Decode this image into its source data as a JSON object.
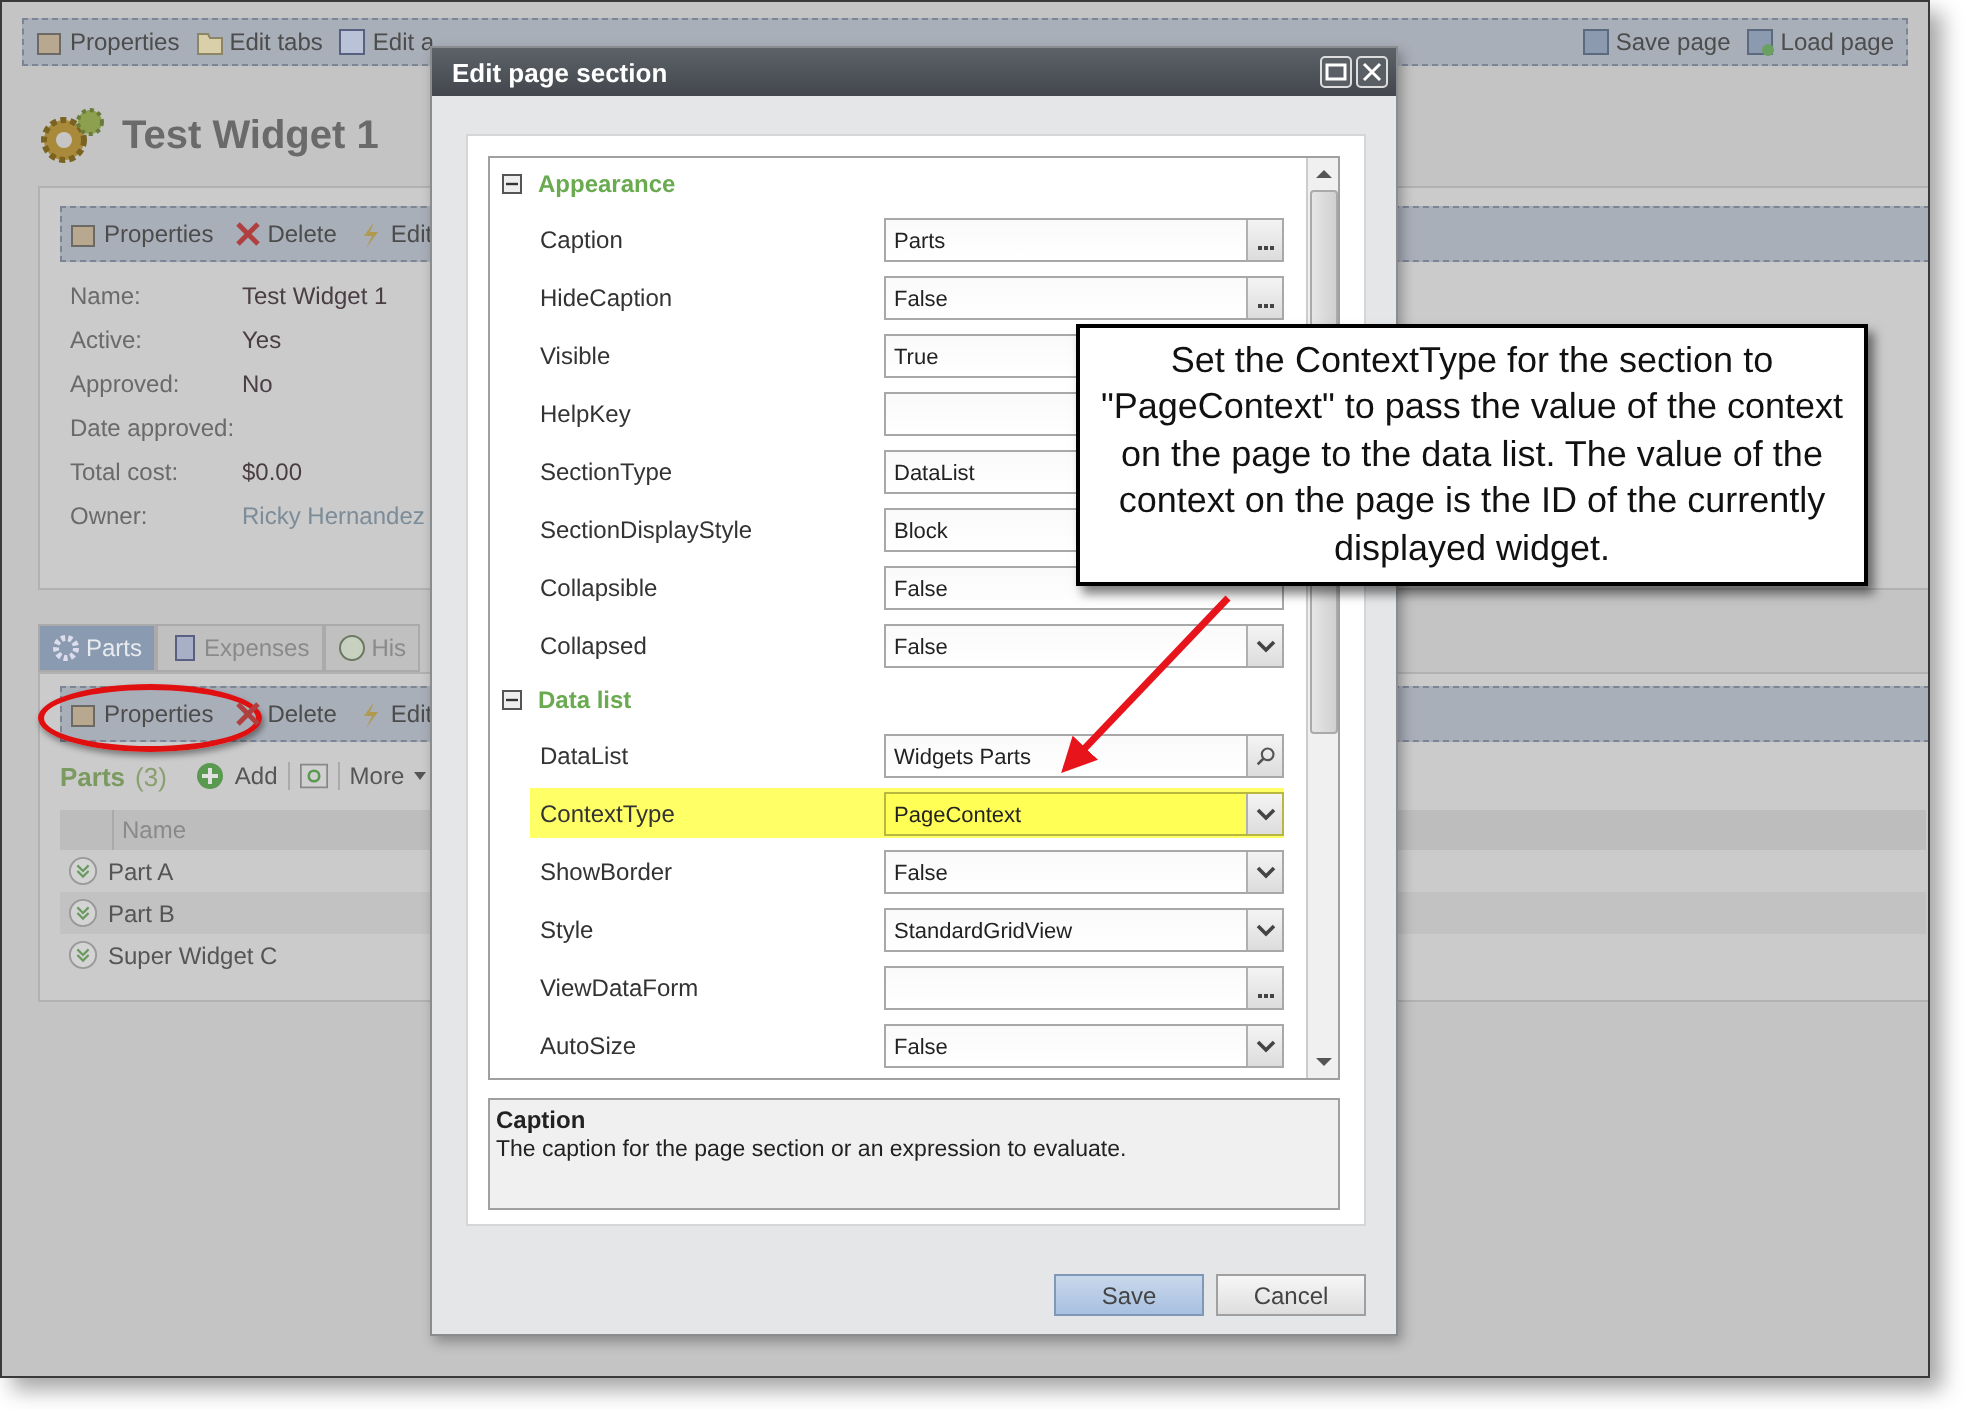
{
  "toolbar": {
    "left": [
      {
        "label": "Properties"
      },
      {
        "label": "Edit tabs"
      },
      {
        "label": "Edit a"
      }
    ],
    "right": [
      {
        "label": "Save page"
      },
      {
        "label": "Load page"
      }
    ]
  },
  "page_title": "Test Widget 1",
  "details": {
    "actions": [
      {
        "label": "Properties"
      },
      {
        "label": "Delete"
      },
      {
        "label": "Edit"
      }
    ],
    "fields": [
      {
        "label": "Name:",
        "value": "Test Widget 1"
      },
      {
        "label": "Active:",
        "value": "Yes"
      },
      {
        "label": "Approved:",
        "value": "No"
      },
      {
        "label": "Date approved:"
      },
      {
        "label": "Total cost:",
        "value": "$0.00"
      },
      {
        "label": "Owner:",
        "value": "Ricky Hernandez",
        "link": true
      }
    ]
  },
  "tabs": [
    {
      "label": "Parts",
      "selected": true
    },
    {
      "label": "Expenses",
      "selected": false
    },
    {
      "label": "His",
      "selected": false
    }
  ],
  "parts_actions": [
    {
      "label": "Properties",
      "circled": true
    },
    {
      "label": "Delete",
      "circled": false
    },
    {
      "label": "Edit",
      "circled": false
    }
  ],
  "parts_list": {
    "title": "Parts",
    "count": "(3)",
    "add": "Add",
    "more": "More"
  },
  "grid": {
    "columns": [
      "Name"
    ],
    "rows": [
      "Part A",
      "Part B",
      "Super Widget C"
    ]
  },
  "dialog": {
    "title": "Edit page section",
    "categories": [
      {
        "label": "Appearance",
        "expanded": true,
        "properties": [
          {
            "label": "Caption",
            "value": "Parts",
            "kind": "ellipsis",
            "highlighted": false
          },
          {
            "label": "HideCaption",
            "value": "False",
            "kind": "ellipsis",
            "highlighted": false
          },
          {
            "label": "Visible",
            "value": "True",
            "kind": "text",
            "highlighted": false
          },
          {
            "label": "HelpKey",
            "kind": "text",
            "highlighted": false
          },
          {
            "label": "SectionType",
            "value": "DataList",
            "kind": "text",
            "highlighted": false
          },
          {
            "label": "SectionDisplayStyle",
            "value": "Block",
            "kind": "text",
            "highlighted": false
          },
          {
            "label": "Collapsible",
            "value": "False",
            "kind": "text",
            "highlighted": false
          },
          {
            "label": "Collapsed",
            "value": "False",
            "kind": "dropdown",
            "highlighted": false
          }
        ]
      },
      {
        "label": "Data list",
        "expanded": true,
        "properties": [
          {
            "label": "DataList",
            "value": "Widgets Parts",
            "kind": "search",
            "highlighted": false
          },
          {
            "label": "ContextType",
            "value": "PageContext",
            "kind": "dropdown",
            "highlighted": true
          },
          {
            "label": "ShowBorder",
            "value": "False",
            "kind": "dropdown",
            "highlighted": false
          },
          {
            "label": "Style",
            "value": "StandardGridView",
            "kind": "dropdown",
            "highlighted": false
          },
          {
            "label": "ViewDataForm",
            "kind": "ellipsis",
            "highlighted": false
          },
          {
            "label": "AutoSize",
            "value": "False",
            "kind": "dropdown",
            "highlighted": false
          }
        ]
      }
    ],
    "help": {
      "title": "Caption",
      "text": "The caption for the page section or an expression to evaluate."
    },
    "buttons": [
      {
        "label": "Save",
        "primary": true
      },
      {
        "label": "Cancel",
        "primary": false
      }
    ]
  },
  "callout": "Set the ContextType for the section to \"PageContext\" to pass the value of the context on the page to the data list. The value of the context on the page is the ID of the currently displayed widget."
}
